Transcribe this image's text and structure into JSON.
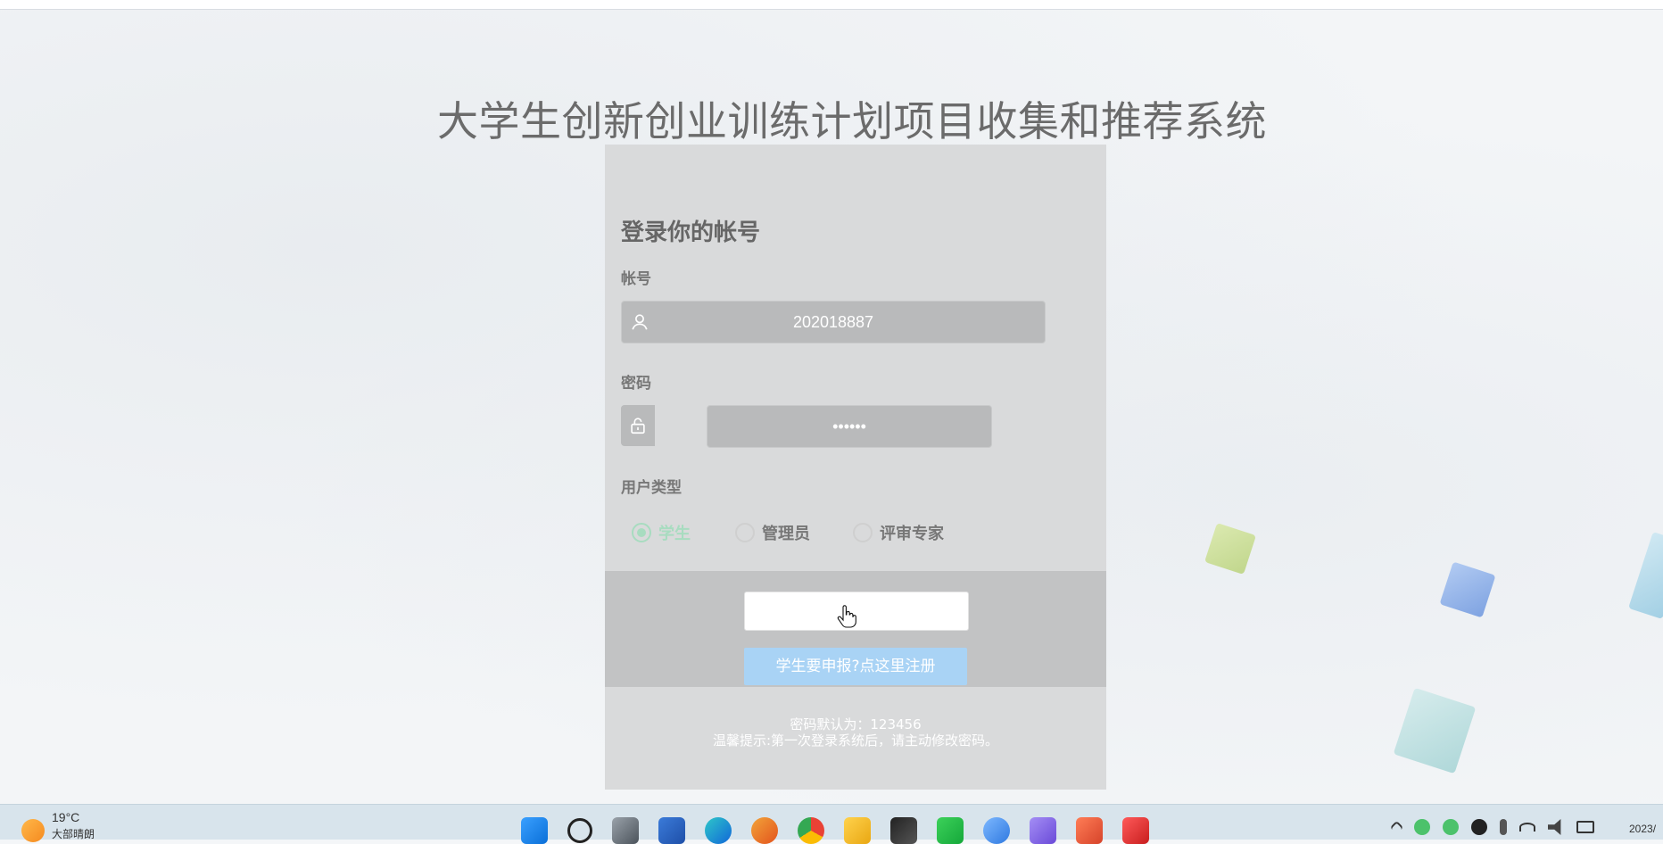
{
  "page": {
    "title": "大学生创新创业训练计划项目收集和推荐系统"
  },
  "login": {
    "heading": "登录你的帐号",
    "account_label": "帐号",
    "account_value": "202018887",
    "password_label": "密码",
    "password_value": "••••••",
    "user_type_label": "用户类型",
    "user_types": [
      {
        "label": "学生",
        "selected": true
      },
      {
        "label": "管理员",
        "selected": false
      },
      {
        "label": "评审专家",
        "selected": false
      }
    ],
    "login_button_label": "",
    "register_button_label": "学生要申报?点这里注册",
    "note_default_password": "密码默认为：123456",
    "note_tip": "温馨提示:第一次登录系统后，请主动修改密码。"
  },
  "taskbar": {
    "temperature": "19°C",
    "weather_desc": "大部晴朗",
    "clock": "2023/"
  },
  "colors": {
    "selected_radio": "#a8dcc0",
    "register_button": "#a9d3f5"
  }
}
